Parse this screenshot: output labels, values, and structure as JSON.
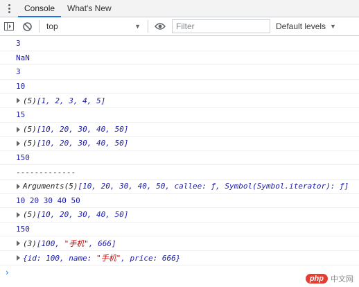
{
  "tabs": [
    {
      "label": "Console",
      "active": true
    },
    {
      "label": "What's New",
      "active": false
    }
  ],
  "toolbar": {
    "context": "top",
    "filter_placeholder": "Filter",
    "levels_label": "Default levels"
  },
  "log": [
    {
      "text": "3",
      "kind": "number"
    },
    {
      "text": "NaN",
      "kind": "number"
    },
    {
      "text": "3",
      "kind": "number"
    },
    {
      "text": "10",
      "kind": "number"
    },
    {
      "prefix": "(5) ",
      "text": "[1, 2, 3, 4, 5]",
      "kind": "array"
    },
    {
      "text": "15",
      "kind": "number"
    },
    {
      "prefix": "(5) ",
      "text": "[10, 20, 30, 40, 50]",
      "kind": "array"
    },
    {
      "prefix": "(5) ",
      "text": "[10, 20, 30, 40, 50]",
      "kind": "array"
    },
    {
      "text": "150",
      "kind": "number"
    },
    {
      "text": "-------------",
      "kind": "plain"
    },
    {
      "prefix": "Arguments(5) ",
      "text": "[10, 20, 30, 40, 50, callee: ƒ, Symbol(Symbol.iterator): ƒ]",
      "kind": "array"
    },
    {
      "text": "10 20 30 40 50",
      "kind": "number"
    },
    {
      "prefix": "(5) ",
      "text": "[10, 20, 30, 40, 50]",
      "kind": "array"
    },
    {
      "text": "150",
      "kind": "number"
    },
    {
      "prefix": "(3) ",
      "text": "[100, \"手机\", 666]",
      "kind": "array"
    },
    {
      "prefix": "",
      "text": "{id: 100, name: \"手机\", price: 666}",
      "kind": "object"
    }
  ],
  "prompt": "›",
  "watermark": {
    "logo": "php",
    "text": "中文网"
  },
  "colors": {
    "number": "#1a1aa6",
    "string": "#c80000",
    "accent": "#1a73e8"
  }
}
